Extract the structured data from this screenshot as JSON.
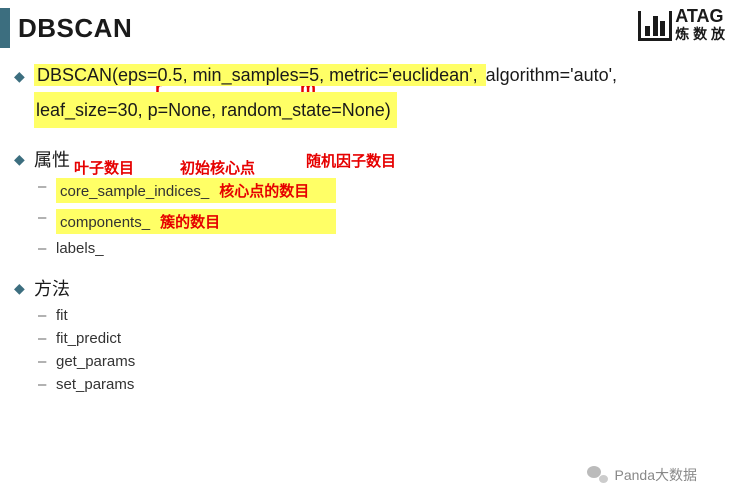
{
  "title": "DBSCAN",
  "logo": {
    "top": "ATAG",
    "bottom": "炼 数 放"
  },
  "signature": {
    "line1_hl": "DBSCAN(eps=0.5, min_samples=5, metric='euclidean', ",
    "line1_rest": "algorithm='auto',",
    "line2_hl": "leaf_size=30, p=None, random_state=None)"
  },
  "annotations": {
    "r": "r",
    "m": "m",
    "leaf": "叶子数目",
    "init_core": "初始核心点",
    "random": "随机因子数目"
  },
  "sections": {
    "attrs": {
      "heading": "属性",
      "items": [
        {
          "name": "core_sample_indices_",
          "note": "核心点的数目",
          "hl": true
        },
        {
          "name": "components_",
          "note": "簇的数目",
          "hl": true
        },
        {
          "name": "labels_",
          "note": "",
          "hl": false
        }
      ]
    },
    "methods": {
      "heading": "方法",
      "items": [
        "fit",
        "fit_predict",
        "get_params",
        "set_params"
      ]
    }
  },
  "footer": "Panda大数据"
}
